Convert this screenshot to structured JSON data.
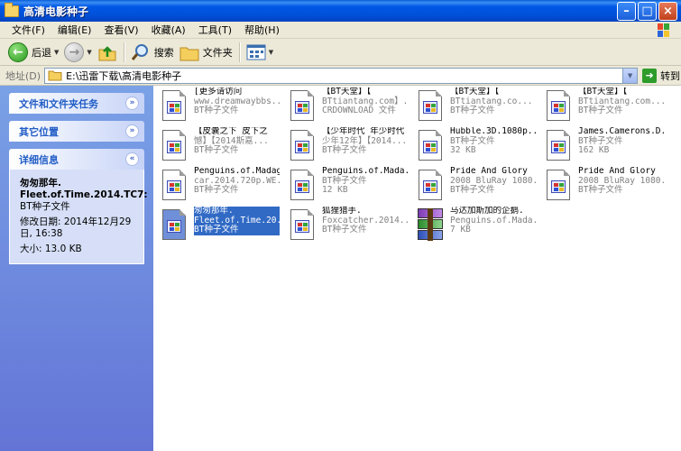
{
  "window": {
    "title": "高清电影种子"
  },
  "menu": [
    "文件(F)",
    "编辑(E)",
    "查看(V)",
    "收藏(A)",
    "工具(T)",
    "帮助(H)"
  ],
  "toolbar": {
    "back": "后退",
    "search": "搜索",
    "folders": "文件夹"
  },
  "address": {
    "label": "地址(D)",
    "path": "E:\\迅雷下载\\高清电影种子",
    "go": "转到"
  },
  "sidebar": {
    "tasks_title": "文件和文件夹任务",
    "places_title": "其它位置",
    "details_title": "详细信息",
    "details": {
      "name_line1": "匆匆那年.",
      "name_line2": "Fleet.of.Time.2014.TC7:",
      "type": "BT种子文件",
      "modified_label": "修改日期:",
      "modified_value": "2014年12月29日, 16:38",
      "size": "大小: 13.0 KB"
    }
  },
  "files": [
    {
      "l1": "[更多请访问",
      "l2": "www.dreamwaybbs....",
      "l3": "BT种子文件",
      "icon": "torrent"
    },
    {
      "l1": "【BT天堂】【",
      "l2": "BTtiantang.com】...",
      "l3": "CRDOWNLOAD 文件",
      "icon": "torrent"
    },
    {
      "l1": "【BT天堂】【",
      "l2": "BTtiantang.co...",
      "l3": "BT种子文件",
      "icon": "torrent"
    },
    {
      "l1": "【BT天堂】【",
      "l2": "BTtiantang.com...",
      "l3": "BT种子文件",
      "icon": "torrent"
    },
    {
      "l1": "【皮囊之下 皮下之",
      "l2": "憾】【2014斯嘉...",
      "l3": "BT种子文件",
      "icon": "torrent"
    },
    {
      "l1": "【少年时代 年少时代",
      "l2": "少年12年】【2014...",
      "l3": "BT种子文件",
      "icon": "torrent"
    },
    {
      "l1": "Hubble.3D.1080p....",
      "l2": "BT种子文件",
      "l3": "32 KB",
      "icon": "torrent"
    },
    {
      "l1": "James.Camerons.D...",
      "l2": "BT种子文件",
      "l3": "162 KB",
      "icon": "torrent"
    },
    {
      "l1": "Penguins.of.Madagas",
      "l2": "car.2014.720p.WE...",
      "l3": "BT种子文件",
      "icon": "torrent"
    },
    {
      "l1": "Penguins.of.Mada...",
      "l2": "BT种子文件",
      "l3": "12 KB",
      "icon": "torrent"
    },
    {
      "l1": "Pride And Glory",
      "l2": "2008 BluRay 1080...",
      "l3": "BT种子文件",
      "icon": "torrent"
    },
    {
      "l1": "Pride And Glory",
      "l2": "2008 BluRay 1080...",
      "l3": "BT种子文件",
      "icon": "torrent"
    },
    {
      "l1": "匆匆那年.",
      "l2": "Fleet.of.Time.20...",
      "l3": "BT种子文件",
      "icon": "torrent",
      "selected": true
    },
    {
      "l1": "狐狸猎手.",
      "l2": "Foxcatcher.2014....",
      "l3": "BT种子文件",
      "icon": "torrent"
    },
    {
      "l1": "马达加斯加的企鹅.",
      "l2": "Penguins.of.Mada...",
      "l3": "7 KB",
      "icon": "rar"
    }
  ],
  "colors": {
    "sidebar": "#6a86dc",
    "selection": "#316ac5",
    "titlebar": "#0054e3"
  }
}
